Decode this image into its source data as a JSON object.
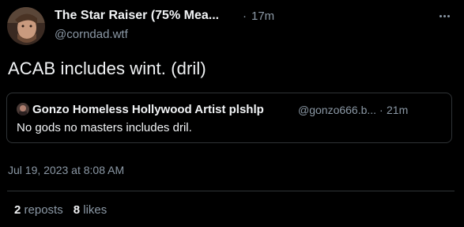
{
  "post": {
    "author_name": "The Star Raiser (75% Mea...",
    "separator": "·",
    "relative_time": "17m",
    "handle": "@corndad.wtf",
    "text": "ACAB includes wint. (dril)",
    "menu_icon": "more-horizontal-icon"
  },
  "quote": {
    "author_name": "Gonzo Homeless Hollywood Artist plshlp",
    "handle": "@gonzo666.b...",
    "separator": "·",
    "relative_time": "21m",
    "text": "No gods no masters includes dril."
  },
  "meta": {
    "full_date": "Jul 19, 2023 at 8:08 AM"
  },
  "stats": {
    "reposts_count": "2",
    "reposts_label": "reposts",
    "likes_count": "8",
    "likes_label": "likes"
  },
  "colors": {
    "background": "#000000",
    "primary_text": "#f1f3f5",
    "secondary_text": "#8b98a5",
    "border": "#2f3336"
  }
}
